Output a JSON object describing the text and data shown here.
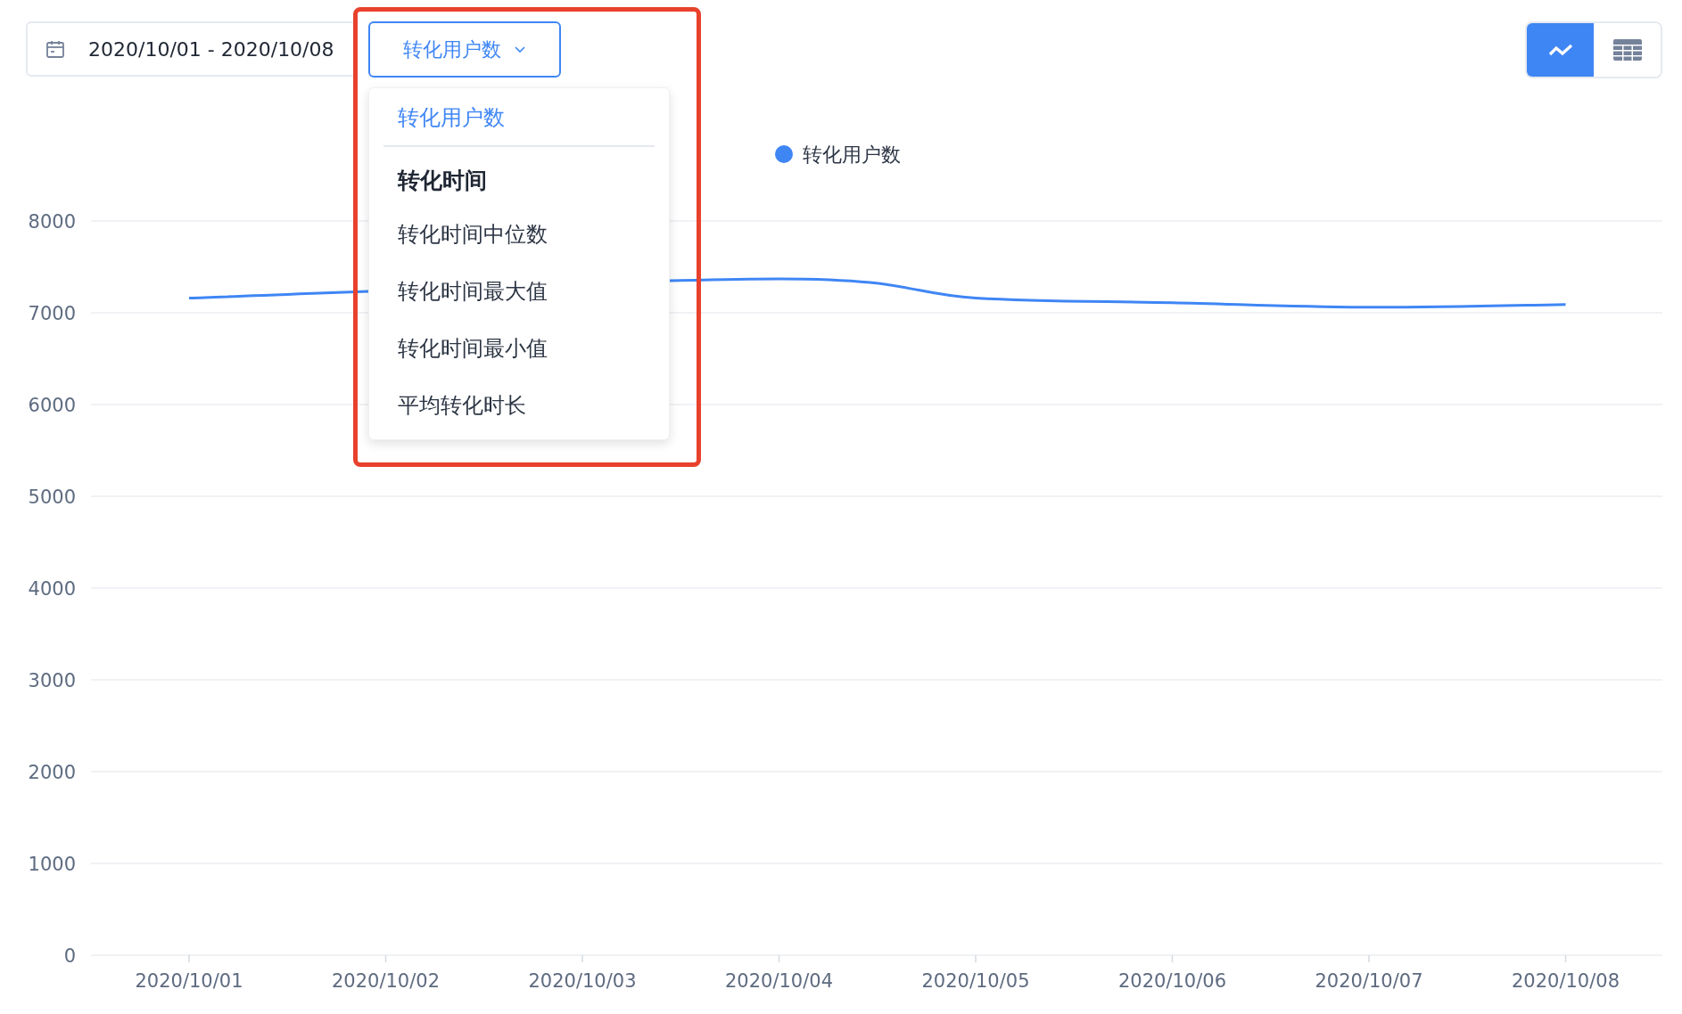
{
  "date_range": {
    "value": "2020/10/01 - 2020/10/08"
  },
  "metric_select": {
    "value": "转化用户数",
    "expanded": true
  },
  "menu": [
    {
      "kind": "option",
      "label": "转化用户数",
      "selected": true
    },
    {
      "kind": "group_header",
      "label": "转化时间",
      "selected": false
    },
    {
      "kind": "option",
      "label": "转化时间中位数",
      "selected": false
    },
    {
      "kind": "option",
      "label": "转化时间最大值",
      "selected": false
    },
    {
      "kind": "option",
      "label": "转化时间最小值",
      "selected": false
    },
    {
      "kind": "option",
      "label": "平均转化时长",
      "selected": false
    }
  ],
  "view_toggle": [
    {
      "kind": "line",
      "selected": true
    },
    {
      "kind": "table",
      "selected": false
    }
  ],
  "chart": {
    "chart_data": {
      "type": "line",
      "categories": [
        "2020/10/01",
        "2020/10/02",
        "2020/10/03",
        "2020/10/04",
        "2020/10/05",
        "2020/10/06",
        "2020/10/07",
        "2020/10/08"
      ],
      "series": [
        {
          "name": "转化用户数",
          "color": "#3f86f5",
          "values": [
            7160,
            null,
            null,
            7370,
            7160,
            7110,
            7060,
            7090
          ]
        }
      ],
      "grid": true,
      "ylim": [
        0,
        8000
      ],
      "yticks": [
        0,
        1000,
        2000,
        3000,
        4000,
        5000,
        6000,
        7000,
        8000
      ]
    }
  }
}
